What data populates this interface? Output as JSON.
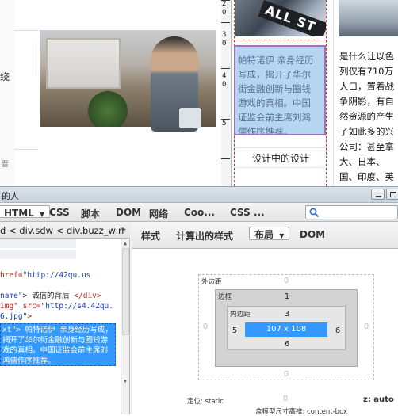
{
  "webpage": {
    "left_fragments": {
      "top": "绕",
      "bottom": "晋"
    },
    "ruler": {
      "labels": [
        "2",
        "0",
        "3",
        "0",
        "4",
        "0",
        "5"
      ]
    },
    "streetsign_text": "ALL ST",
    "highlight_text": "帕特诺伊 亲身经历写成，揭开了华尔街金融创新与圈钱游戏的真相。中国证监会前主席刘鸿儒作序推荐。",
    "caption": "设计中的设计",
    "right_text": "是什么让以色列仅有710万人口，置着战争阴影，有自然资源的产生了如此多的兴公司：甚至拿大、日本、国、印度、英大国都多?"
  },
  "devtools": {
    "title": "的人",
    "tabs": [
      {
        "label": "HTML",
        "selected": true
      },
      {
        "label": "CSS",
        "selected": false
      },
      {
        "label": "脚本",
        "selected": false
      },
      {
        "label": "DOM",
        "selected": false
      },
      {
        "label": "网络",
        "selected": false
      },
      {
        "label": "Coo...",
        "selected": false
      },
      {
        "label": "CSS ...",
        "selected": false
      }
    ],
    "search_placeholder": "",
    "breadcrumb": {
      "items": [
        "d",
        "div.sdw",
        "div.buzz_win"
      ],
      "separator": "<",
      "more_arrow": "▸"
    },
    "html_lines": [
      {
        "parts": [
          {
            "t": "href=",
            "c": "red"
          },
          {
            "t": "\"http://42qu.us",
            "c": "blue"
          }
        ]
      },
      {
        "parts": [
          {
            "t": "name\"",
            "c": "blue"
          },
          {
            "t": "> 诚信的背后 ",
            "c": "plain"
          },
          {
            "t": "</div>",
            "c": "red"
          }
        ]
      },
      {
        "parts": [
          {
            "t": "img\" src=",
            "c": "red"
          },
          {
            "t": "\"http://s4.42qu.",
            "c": "blue"
          }
        ]
      },
      {
        "parts": [
          {
            "t": "6.jpg\"",
            "c": "blue"
          },
          {
            "t": ">",
            "c": "red"
          }
        ]
      }
    ],
    "selected_code": "xt\"> 帕特诺伊 亲身经历写成，揭开了华尔街金融创新与圈钱游戏的真相。中国证监会前主席刘鸿儒作序推荐。",
    "side_tabs": [
      {
        "label": "样式",
        "selected": false
      },
      {
        "label": "计算出的样式",
        "selected": false
      },
      {
        "label": "布局",
        "selected": true
      },
      {
        "label": "DOM",
        "selected": false
      }
    ],
    "layout": {
      "margin_label": "外边距",
      "border_label": "边框",
      "padding_label": "内边距",
      "margin": {
        "top": "0",
        "right": "0",
        "bottom": "0",
        "left": "0"
      },
      "border": {
        "top": "1",
        "right": "",
        "bottom": "",
        "left": ""
      },
      "padding": {
        "top": "3",
        "right": "6",
        "bottom": "6",
        "left": "5"
      },
      "content": "107 x 108",
      "outer_bottom": "0",
      "position_text": "定位: static",
      "zindex_text": "z: auto",
      "box_sizing_text": "盒模型尺寸高推: content-box"
    },
    "colors": {
      "content_blue": "#3399ff",
      "selection_blue": "#3399ff"
    }
  }
}
